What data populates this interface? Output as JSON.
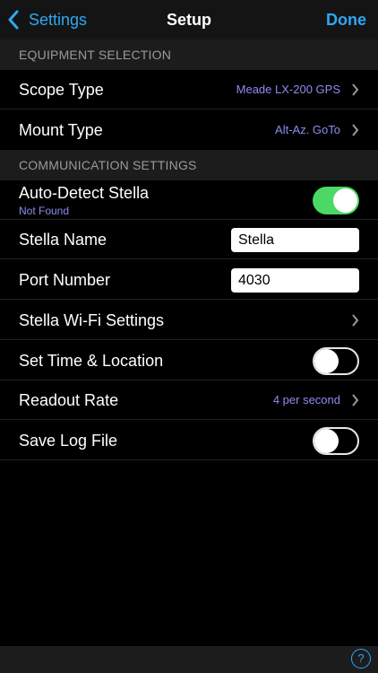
{
  "nav": {
    "back_label": "Settings",
    "title": "Setup",
    "done_label": "Done"
  },
  "sections": {
    "equipment": "EQUIPMENT SELECTION",
    "communication": "COMMUNICATION SETTINGS"
  },
  "equipment": {
    "scope_type": {
      "label": "Scope Type",
      "value": "Meade LX-200 GPS"
    },
    "mount_type": {
      "label": "Mount Type",
      "value": "Alt-Az. GoTo"
    }
  },
  "communication": {
    "auto_detect": {
      "label": "Auto-Detect Stella",
      "status": "Not Found",
      "on": true
    },
    "stella_name": {
      "label": "Stella Name",
      "value": "Stella"
    },
    "port_number": {
      "label": "Port Number",
      "value": "4030"
    },
    "wifi_settings": {
      "label": "Stella Wi-Fi Settings"
    },
    "set_time": {
      "label": "Set Time & Location",
      "on": false
    },
    "readout_rate": {
      "label": "Readout Rate",
      "value": "4 per second"
    },
    "save_log": {
      "label": "Save Log File",
      "on": false
    }
  },
  "footer": {
    "help_label": "?"
  },
  "colors": {
    "accent": "#2ea8f5",
    "value_text": "#8d8cf2",
    "toggle_on": "#4cd864"
  },
  "icons": [
    "chevron-left-icon",
    "chevron-right-icon",
    "help-icon"
  ]
}
